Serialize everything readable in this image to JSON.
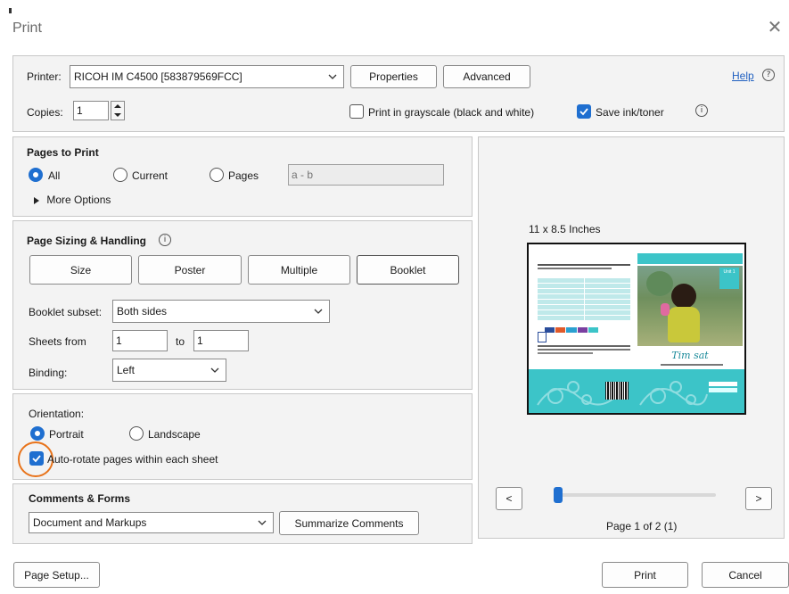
{
  "window": {
    "title": "Print",
    "close_glyph": "✕"
  },
  "header": {
    "printer_label": "Printer:",
    "printer_value": "RICOH IM C4500 [583879569FCC]",
    "properties_label": "Properties",
    "advanced_label": "Advanced",
    "help_label": "Help",
    "copies_label": "Copies:",
    "copies_value": "1",
    "grayscale_label": "Print in grayscale (black and white)",
    "grayscale_checked": false,
    "save_ink_label": "Save ink/toner",
    "save_ink_checked": true
  },
  "pages_to_print": {
    "heading": "Pages to Print",
    "all_label": "All",
    "current_label": "Current",
    "pages_label": "Pages",
    "pages_placeholder": "a - b",
    "selected": "All",
    "more_options_label": "More Options"
  },
  "sizing": {
    "heading": "Page Sizing & Handling",
    "size_label": "Size",
    "poster_label": "Poster",
    "multiple_label": "Multiple",
    "booklet_label": "Booklet",
    "booklet_subset_label": "Booklet subset:",
    "booklet_subset_value": "Both sides",
    "sheets_from_label": "Sheets from",
    "sheets_from_value": "1",
    "to_label": "to",
    "sheets_to_value": "1",
    "binding_label": "Binding:",
    "binding_value": "Left"
  },
  "orientation": {
    "heading": "Orientation:",
    "portrait_label": "Portrait",
    "landscape_label": "Landscape",
    "selected": "Portrait",
    "auto_rotate_label": "Auto-rotate pages within each sheet",
    "auto_rotate_checked": true
  },
  "comments": {
    "heading": "Comments & Forms",
    "value": "Document and Markups",
    "summarize_label": "Summarize Comments"
  },
  "preview": {
    "size_label": "11 x 8.5 Inches",
    "page_text": "Page 1 of 2 (1)",
    "prev_label": "<",
    "next_label": ">",
    "booklet_title": "Tim sat",
    "unit_badge": "Unit 1",
    "slider_position": 0.0
  },
  "footer": {
    "page_setup_label": "Page Setup...",
    "print_label": "Print",
    "cancel_label": "Cancel"
  },
  "colors": {
    "accent": "#1f6fd0",
    "highlight_ring": "#e8731a",
    "teal": "#3cc4c8"
  }
}
